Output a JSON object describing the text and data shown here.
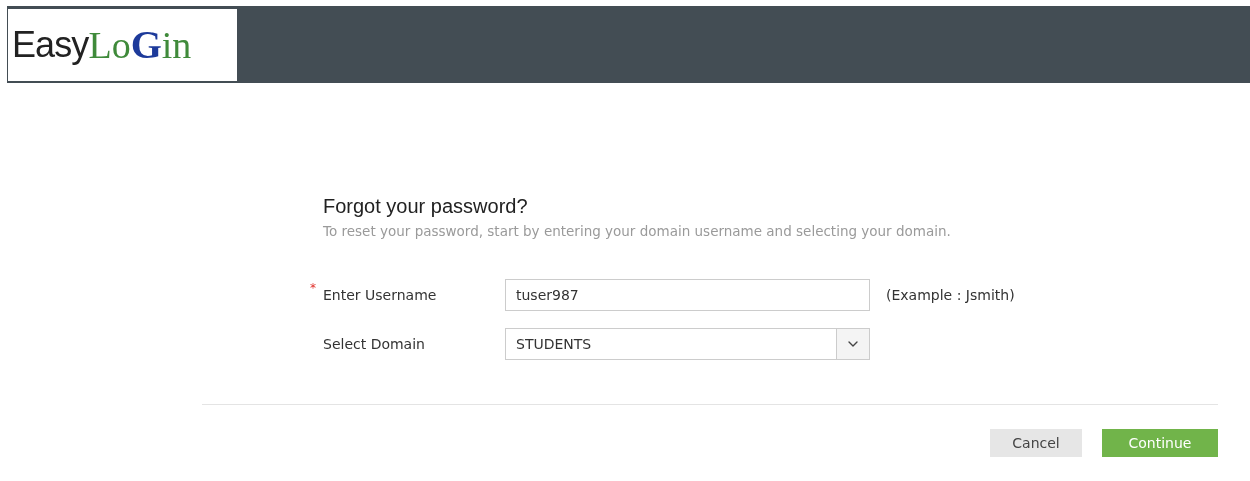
{
  "logo": {
    "parts": [
      {
        "text": "Easy",
        "kind": "sans"
      },
      {
        "text": "Lo",
        "kind": "serif"
      },
      {
        "text": "G",
        "kind": "swirl"
      },
      {
        "text": "in",
        "kind": "serif"
      }
    ]
  },
  "form": {
    "title": "Forgot your password?",
    "subtitle": "To reset your password, start by entering your domain username and selecting your domain.",
    "fields": [
      {
        "kind": "text",
        "label": "Enter Username",
        "required_mark": "*",
        "value": "tuser987",
        "hint": "(Example : Jsmith)"
      },
      {
        "kind": "select",
        "label": "Select Domain",
        "value": "STUDENTS"
      }
    ]
  },
  "buttons": [
    {
      "label": "Cancel",
      "kind": "secondary"
    },
    {
      "label": "Continue",
      "kind": "primary"
    }
  ]
}
